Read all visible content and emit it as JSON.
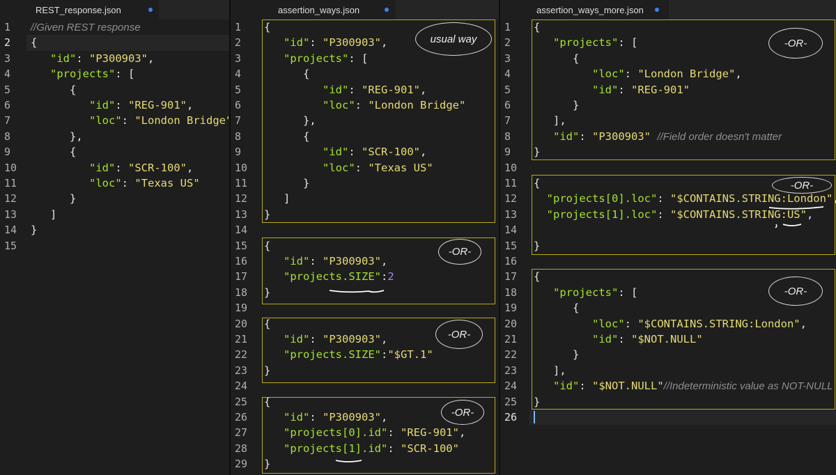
{
  "tabs": [
    {
      "name": "REST_response.json"
    },
    {
      "name": "assertion_ways.json"
    },
    {
      "name": "assertion_ways_more.json"
    }
  ],
  "annotations": {
    "usual": "usual way",
    "or": "-OR-"
  },
  "colors": {
    "key": "#a6e22e",
    "string": "#e6db74",
    "number": "#ae81ff",
    "comment": "#8e8e8e",
    "box_border": "#b9ab1d",
    "tab_modified_dot": "#3b82f6"
  },
  "panes": [
    {
      "line_count": 15,
      "active_line": 2,
      "lines": [
        [
          {
            "t": "c",
            "v": "//Given REST response"
          }
        ],
        [
          {
            "t": "p",
            "v": "{"
          }
        ],
        [
          {
            "t": "p",
            "v": "   "
          },
          {
            "t": "k",
            "v": "\"id\""
          },
          {
            "t": "p",
            "v": ": "
          },
          {
            "t": "s",
            "v": "\"P300903\""
          },
          {
            "t": "p",
            "v": ","
          }
        ],
        [
          {
            "t": "p",
            "v": "   "
          },
          {
            "t": "k",
            "v": "\"projects\""
          },
          {
            "t": "p",
            "v": ": ["
          }
        ],
        [
          {
            "t": "p",
            "v": "      {"
          }
        ],
        [
          {
            "t": "p",
            "v": "         "
          },
          {
            "t": "k",
            "v": "\"id\""
          },
          {
            "t": "p",
            "v": ": "
          },
          {
            "t": "s",
            "v": "\"REG-901\""
          },
          {
            "t": "p",
            "v": ","
          }
        ],
        [
          {
            "t": "p",
            "v": "         "
          },
          {
            "t": "k",
            "v": "\"loc\""
          },
          {
            "t": "p",
            "v": ": "
          },
          {
            "t": "s",
            "v": "\"London Bridge\""
          }
        ],
        [
          {
            "t": "p",
            "v": "      },"
          }
        ],
        [
          {
            "t": "p",
            "v": "      {"
          }
        ],
        [
          {
            "t": "p",
            "v": "         "
          },
          {
            "t": "k",
            "v": "\"id\""
          },
          {
            "t": "p",
            "v": ": "
          },
          {
            "t": "s",
            "v": "\"SCR-100\""
          },
          {
            "t": "p",
            "v": ","
          }
        ],
        [
          {
            "t": "p",
            "v": "         "
          },
          {
            "t": "k",
            "v": "\"loc\""
          },
          {
            "t": "p",
            "v": ": "
          },
          {
            "t": "s",
            "v": "\"Texas US\""
          }
        ],
        [
          {
            "t": "p",
            "v": "      }"
          }
        ],
        [
          {
            "t": "p",
            "v": "   ]"
          }
        ],
        [
          {
            "t": "p",
            "v": "}"
          }
        ],
        []
      ]
    },
    {
      "line_count": 29,
      "lines": [
        [
          {
            "t": "p",
            "v": "{"
          }
        ],
        [
          {
            "t": "p",
            "v": "   "
          },
          {
            "t": "k",
            "v": "\"id\""
          },
          {
            "t": "p",
            "v": ": "
          },
          {
            "t": "s",
            "v": "\"P300903\""
          },
          {
            "t": "p",
            "v": ","
          }
        ],
        [
          {
            "t": "p",
            "v": "   "
          },
          {
            "t": "k",
            "v": "\"projects\""
          },
          {
            "t": "p",
            "v": ": ["
          }
        ],
        [
          {
            "t": "p",
            "v": "      {"
          }
        ],
        [
          {
            "t": "p",
            "v": "         "
          },
          {
            "t": "k",
            "v": "\"id\""
          },
          {
            "t": "p",
            "v": ": "
          },
          {
            "t": "s",
            "v": "\"REG-901\""
          },
          {
            "t": "p",
            "v": ","
          }
        ],
        [
          {
            "t": "p",
            "v": "         "
          },
          {
            "t": "k",
            "v": "\"loc\""
          },
          {
            "t": "p",
            "v": ": "
          },
          {
            "t": "s",
            "v": "\"London Bridge\""
          }
        ],
        [
          {
            "t": "p",
            "v": "      },"
          }
        ],
        [
          {
            "t": "p",
            "v": "      {"
          }
        ],
        [
          {
            "t": "p",
            "v": "         "
          },
          {
            "t": "k",
            "v": "\"id\""
          },
          {
            "t": "p",
            "v": ": "
          },
          {
            "t": "s",
            "v": "\"SCR-100\""
          },
          {
            "t": "p",
            "v": ","
          }
        ],
        [
          {
            "t": "p",
            "v": "         "
          },
          {
            "t": "k",
            "v": "\"loc\""
          },
          {
            "t": "p",
            "v": ": "
          },
          {
            "t": "s",
            "v": "\"Texas US\""
          }
        ],
        [
          {
            "t": "p",
            "v": "      }"
          }
        ],
        [
          {
            "t": "p",
            "v": "   ]"
          }
        ],
        [
          {
            "t": "p",
            "v": "}"
          }
        ],
        [],
        [
          {
            "t": "p",
            "v": "{"
          }
        ],
        [
          {
            "t": "p",
            "v": "   "
          },
          {
            "t": "k",
            "v": "\"id\""
          },
          {
            "t": "p",
            "v": ": "
          },
          {
            "t": "s",
            "v": "\"P300903\""
          },
          {
            "t": "p",
            "v": ","
          }
        ],
        [
          {
            "t": "p",
            "v": "   "
          },
          {
            "t": "k",
            "v": "\"projects.SIZE\""
          },
          {
            "t": "p",
            "v": ":"
          },
          {
            "t": "n",
            "v": "2"
          }
        ],
        [
          {
            "t": "p",
            "v": "}"
          }
        ],
        [],
        [
          {
            "t": "p",
            "v": "{"
          }
        ],
        [
          {
            "t": "p",
            "v": "   "
          },
          {
            "t": "k",
            "v": "\"id\""
          },
          {
            "t": "p",
            "v": ": "
          },
          {
            "t": "s",
            "v": "\"P300903\""
          },
          {
            "t": "p",
            "v": ","
          }
        ],
        [
          {
            "t": "p",
            "v": "   "
          },
          {
            "t": "k",
            "v": "\"projects.SIZE\""
          },
          {
            "t": "p",
            "v": ":"
          },
          {
            "t": "s",
            "v": "\"$GT.1\""
          }
        ],
        [
          {
            "t": "p",
            "v": "}"
          }
        ],
        [],
        [
          {
            "t": "p",
            "v": "{"
          }
        ],
        [
          {
            "t": "p",
            "v": "   "
          },
          {
            "t": "k",
            "v": "\"id\""
          },
          {
            "t": "p",
            "v": ": "
          },
          {
            "t": "s",
            "v": "\"P300903\""
          },
          {
            "t": "p",
            "v": ","
          }
        ],
        [
          {
            "t": "p",
            "v": "   "
          },
          {
            "t": "k",
            "v": "\"projects[0].id\""
          },
          {
            "t": "p",
            "v": ": "
          },
          {
            "t": "s",
            "v": "\"REG-901\""
          },
          {
            "t": "p",
            "v": ","
          }
        ],
        [
          {
            "t": "p",
            "v": "   "
          },
          {
            "t": "k",
            "v": "\"projects[1].id\""
          },
          {
            "t": "p",
            "v": ": "
          },
          {
            "t": "s",
            "v": "\"SCR-100\""
          }
        ],
        [
          {
            "t": "p",
            "v": "}"
          }
        ]
      ]
    },
    {
      "line_count": 26,
      "active_line": 26,
      "lines": [
        [
          {
            "t": "p",
            "v": "{"
          }
        ],
        [
          {
            "t": "p",
            "v": "   "
          },
          {
            "t": "k",
            "v": "\"projects\""
          },
          {
            "t": "p",
            "v": ": ["
          }
        ],
        [
          {
            "t": "p",
            "v": "      {"
          }
        ],
        [
          {
            "t": "p",
            "v": "         "
          },
          {
            "t": "k",
            "v": "\"loc\""
          },
          {
            "t": "p",
            "v": ": "
          },
          {
            "t": "s",
            "v": "\"London Bridge\""
          },
          {
            "t": "p",
            "v": ","
          }
        ],
        [
          {
            "t": "p",
            "v": "         "
          },
          {
            "t": "k",
            "v": "\"id\""
          },
          {
            "t": "p",
            "v": ": "
          },
          {
            "t": "s",
            "v": "\"REG-901\""
          }
        ],
        [
          {
            "t": "p",
            "v": "      }"
          }
        ],
        [
          {
            "t": "p",
            "v": "   ],"
          }
        ],
        [
          {
            "t": "p",
            "v": "   "
          },
          {
            "t": "k",
            "v": "\"id\""
          },
          {
            "t": "p",
            "v": ": "
          },
          {
            "t": "s",
            "v": "\"P300903\""
          },
          {
            "t": "p",
            "v": " "
          },
          {
            "t": "c",
            "v": "//Field order doesn't matter"
          }
        ],
        [
          {
            "t": "p",
            "v": "}"
          }
        ],
        [],
        [
          {
            "t": "p",
            "v": "{"
          }
        ],
        [
          {
            "t": "p",
            "v": "  "
          },
          {
            "t": "k",
            "v": "\"projects[0].loc\""
          },
          {
            "t": "p",
            "v": ": "
          },
          {
            "t": "s",
            "v": "\"$CONTAINS.STRING:London\""
          },
          {
            "t": "p",
            "v": ","
          }
        ],
        [
          {
            "t": "p",
            "v": "  "
          },
          {
            "t": "k",
            "v": "\"projects[1].loc\""
          },
          {
            "t": "p",
            "v": ": "
          },
          {
            "t": "s",
            "v": "\"$CONTAINS.STRING:US\""
          },
          {
            "t": "p",
            "v": ","
          }
        ],
        [],
        [
          {
            "t": "p",
            "v": "}"
          }
        ],
        [],
        [
          {
            "t": "p",
            "v": "{"
          }
        ],
        [
          {
            "t": "p",
            "v": "   "
          },
          {
            "t": "k",
            "v": "\"projects\""
          },
          {
            "t": "p",
            "v": ": ["
          }
        ],
        [
          {
            "t": "p",
            "v": "      {"
          }
        ],
        [
          {
            "t": "p",
            "v": "         "
          },
          {
            "t": "k",
            "v": "\"loc\""
          },
          {
            "t": "p",
            "v": ": "
          },
          {
            "t": "s",
            "v": "\"$CONTAINS.STRING:London\""
          },
          {
            "t": "p",
            "v": ","
          }
        ],
        [
          {
            "t": "p",
            "v": "         "
          },
          {
            "t": "k",
            "v": "\"id\""
          },
          {
            "t": "p",
            "v": ": "
          },
          {
            "t": "s",
            "v": "\"$NOT.NULL\""
          }
        ],
        [
          {
            "t": "p",
            "v": "      }"
          }
        ],
        [
          {
            "t": "p",
            "v": "   ],"
          }
        ],
        [
          {
            "t": "p",
            "v": "   "
          },
          {
            "t": "k",
            "v": "\"id\""
          },
          {
            "t": "p",
            "v": ": "
          },
          {
            "t": "s",
            "v": "\"$NOT.NULL\""
          },
          {
            "t": "c",
            "v": "//Indeterministic value as NOT-NULL"
          }
        ],
        [
          {
            "t": "p",
            "v": "}"
          }
        ],
        []
      ]
    }
  ]
}
